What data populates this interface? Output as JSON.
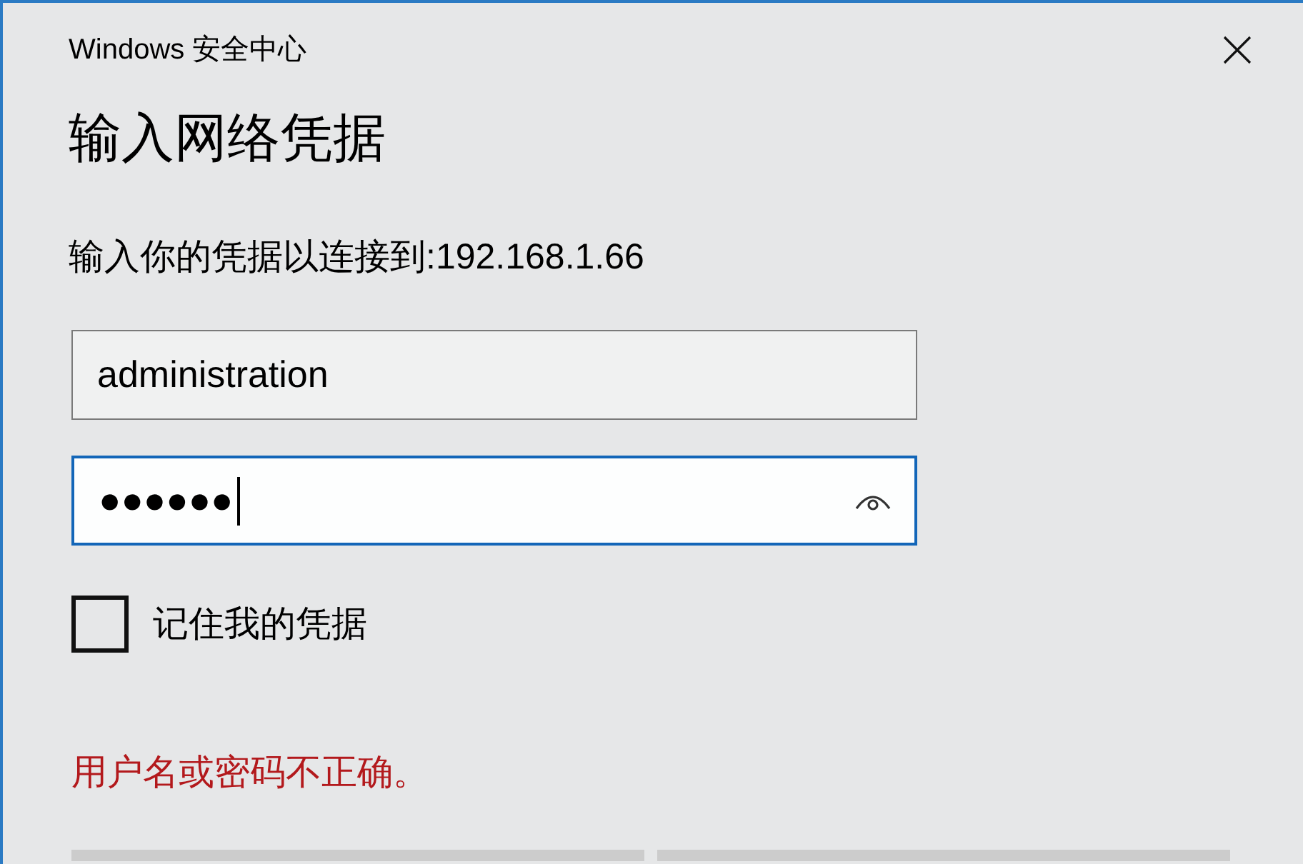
{
  "window": {
    "title": "Windows 安全中心"
  },
  "heading": "输入网络凭据",
  "prompt": "输入你的凭据以连接到:192.168.1.66",
  "username_field": {
    "value": "administration",
    "focused": false
  },
  "password_field": {
    "value": "●●●●●●",
    "focused": true
  },
  "remember_checkbox": {
    "label": "记住我的凭据",
    "checked": false
  },
  "error_message": "用户名或密码不正确。",
  "buttons": [
    {
      "kind": "plain"
    },
    {
      "kind": "plain"
    }
  ]
}
